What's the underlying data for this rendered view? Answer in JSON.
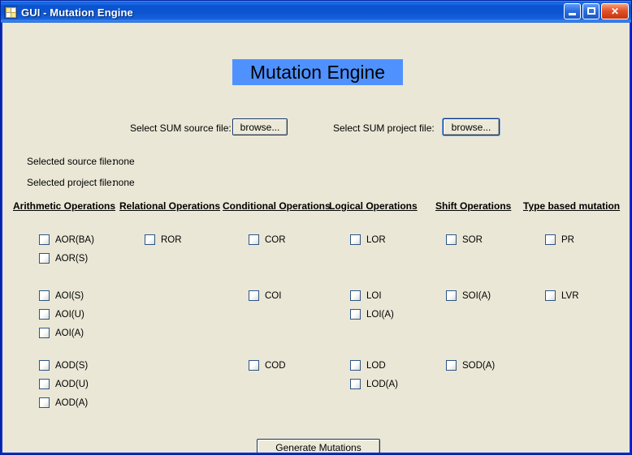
{
  "window": {
    "title": "GUI - Mutation Engine",
    "icon": "form-app-icon",
    "controls": [
      {
        "name": "minimize-button",
        "glyph": "_"
      },
      {
        "name": "maximize-button",
        "glyph": "□"
      },
      {
        "name": "close-button",
        "glyph": "✕"
      }
    ],
    "accent_titlebar": "#0c53cf",
    "client_bg": "#eae7d6"
  },
  "heading": {
    "text": "Mutation Engine",
    "highlight_color": "#4f92ff"
  },
  "file_selection": {
    "source_label": "Select SUM source file:",
    "source_browse_label": "browse...",
    "project_label": "Select SUM project file:",
    "project_browse_label": "browse..."
  },
  "status": {
    "selected_source_label": "Selected source file:",
    "selected_source_value": "none",
    "selected_project_label": "Selected project file:",
    "selected_project_value": "none"
  },
  "columns": [
    {
      "header": "Arithmetic Operations",
      "groups": [
        [
          "AOR(BA)",
          "AOR(S)"
        ],
        [
          "AOI(S)",
          "AOI(U)",
          "AOI(A)"
        ],
        [
          "AOD(S)",
          "AOD(U)",
          "AOD(A)"
        ]
      ]
    },
    {
      "header": "Relational Operations",
      "groups": [
        [
          "ROR"
        ],
        [],
        []
      ]
    },
    {
      "header": "Conditional Operations",
      "groups": [
        [
          "COR"
        ],
        [
          "COI"
        ],
        [
          "COD"
        ]
      ]
    },
    {
      "header": "Logical Operations",
      "groups": [
        [
          "LOR"
        ],
        [
          "LOI",
          "LOI(A)"
        ],
        [
          "LOD",
          "LOD(A)"
        ]
      ]
    },
    {
      "header": "Shift Operations",
      "groups": [
        [
          "SOR"
        ],
        [
          "SOI(A)"
        ],
        [
          "SOD(A)"
        ]
      ]
    },
    {
      "header": "Type based mutation",
      "groups": [
        [
          "PR"
        ],
        [
          "LVR"
        ],
        []
      ]
    }
  ],
  "actions": {
    "generate_label": "Generate Mutations"
  }
}
